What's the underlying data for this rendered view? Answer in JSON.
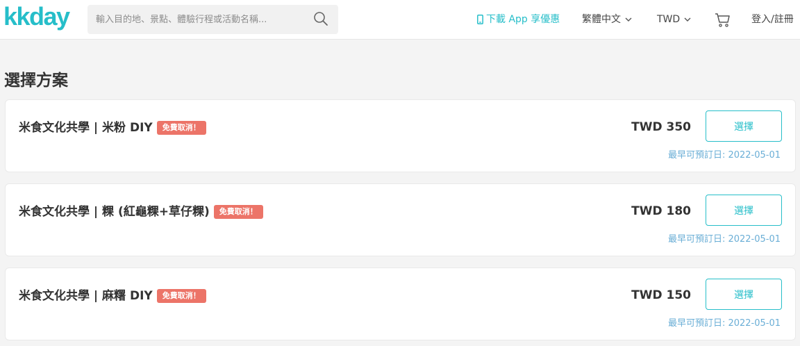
{
  "header": {
    "logo_text": "kkday",
    "search_placeholder": "輸入目的地、景點、體驗行程或活動名稱...",
    "app_download": "下載 App 享優惠",
    "language": "繁體中文",
    "currency": "TWD",
    "login": "登入/註冊"
  },
  "section_title": "選擇方案",
  "plans": [
    {
      "title": "米食文化共學 | 米粉 DIY",
      "badge": "免費取消！",
      "price": "TWD 350",
      "button": "選擇",
      "earliest": "最早可預訂日: 2022-05-01"
    },
    {
      "title": "米食文化共學 | 粿 (紅龜粿+草仔粿)",
      "badge": "免費取消！",
      "price": "TWD 180",
      "button": "選擇",
      "earliest": "最早可預訂日: 2022-05-01"
    },
    {
      "title": "米食文化共學 | 麻糬 DIY",
      "badge": "免費取消！",
      "price": "TWD 150",
      "button": "選擇",
      "earliest": "最早可預訂日: 2022-05-01"
    }
  ],
  "colors": {
    "brand": "#26bec9",
    "badge": "#ec7468",
    "date": "#6aaed6",
    "background": "#f4f4f4"
  }
}
